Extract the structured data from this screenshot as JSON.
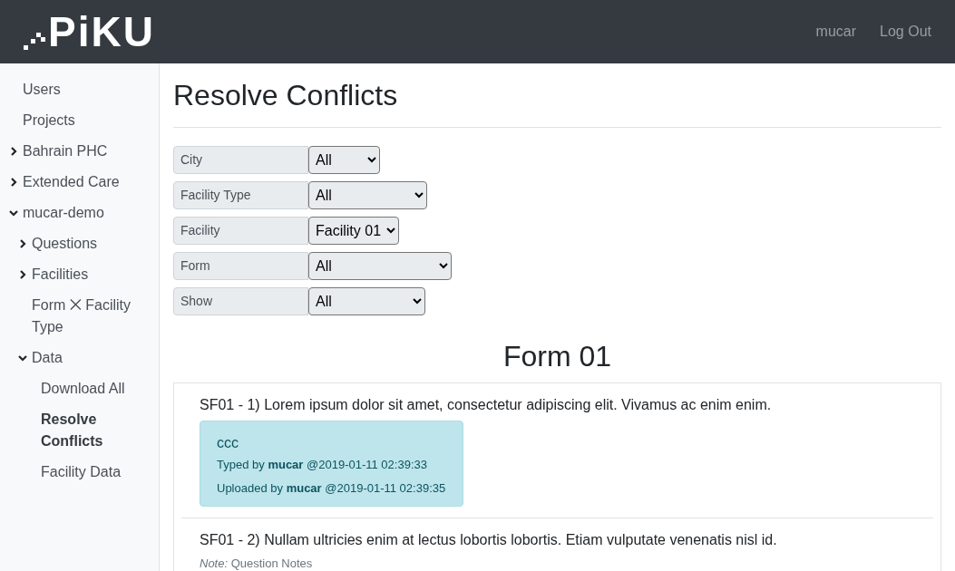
{
  "header": {
    "logo": "PiKU",
    "user": "mucar",
    "logout": "Log Out"
  },
  "sidebar": {
    "items": [
      {
        "kind": "link",
        "label": "Users",
        "selected": false
      },
      {
        "kind": "link",
        "label": "Projects",
        "selected": false
      },
      {
        "kind": "folder",
        "label": "Bahrain PHC",
        "expanded": false,
        "selected": false
      },
      {
        "kind": "folder",
        "label": "Extended Care",
        "expanded": false,
        "selected": false
      },
      {
        "kind": "folder",
        "label": "mucar-demo",
        "expanded": true,
        "selected": false,
        "children": [
          {
            "kind": "folder",
            "label": "Questions",
            "expanded": false,
            "selected": false
          },
          {
            "kind": "folder",
            "label": "Facilities",
            "expanded": false,
            "selected": false
          },
          {
            "kind": "link",
            "label": "Form ⨉ Facility Type",
            "selected": false
          },
          {
            "kind": "folder",
            "label": "Data",
            "expanded": true,
            "selected": false,
            "children": [
              {
                "kind": "link",
                "label": "Download All",
                "selected": false
              },
              {
                "kind": "link",
                "label": "Resolve Conflicts",
                "selected": true
              },
              {
                "kind": "link",
                "label": "Facility Data",
                "selected": false
              }
            ]
          }
        ]
      }
    ]
  },
  "page": {
    "title": "Resolve Conflicts",
    "filters": [
      {
        "label": "City",
        "value": "All"
      },
      {
        "label": "Facility Type",
        "value": "All"
      },
      {
        "label": "Facility",
        "value": "Facility 01"
      },
      {
        "label": "Form",
        "value": "All"
      },
      {
        "label": "Show",
        "value": "All"
      }
    ],
    "form_title": "Form 01",
    "questions": [
      {
        "text": "SF01 - 1) Lorem ipsum dolor sit amet, consectetur adipiscing elit. Vivamus ac enim enim.",
        "answers": [
          {
            "value": "ccc",
            "typed": "Typed by **mucar** @2019-01-11 02:39:33",
            "uploaded": "Uploaded by **mucar** @2019-01-11 02:39:35"
          }
        ]
      },
      {
        "text": "SF01 - 2) Nullam ultricies enim at lectus lobortis lobortis. Etiam vulputate venenatis nisl id.",
        "note": "*Note:* Question Notes"
      }
    ]
  }
}
